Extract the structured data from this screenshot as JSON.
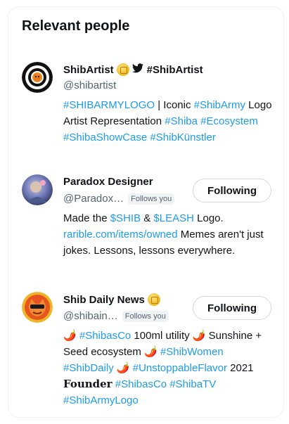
{
  "section": {
    "title": "Relevant people"
  },
  "people": [
    {
      "name": "ShibArtist",
      "name_suffix": "#ShibArtist",
      "handle": "@shibartist",
      "follows_you": "",
      "button": "",
      "bio": [
        {
          "t": "#SHIBARMYLOGO",
          "tag": true
        },
        {
          "t": " | Iconic ",
          "tag": false
        },
        {
          "t": "#ShibArmy",
          "tag": true
        },
        {
          "t": " Logo Artist Representation ",
          "tag": false
        },
        {
          "t": "#Shiba",
          "tag": true
        },
        {
          "t": " ",
          "tag": false
        },
        {
          "t": "#Ecosystem",
          "tag": true
        },
        {
          "t": " ",
          "tag": false
        },
        {
          "t": "#ShibaShowCase",
          "tag": true
        },
        {
          "t": " ",
          "tag": false
        },
        {
          "t": "#ShibKünstler",
          "tag": true
        }
      ]
    },
    {
      "name": "Paradox Designer",
      "name_suffix": "",
      "handle": "@Paradox…",
      "follows_you": "Follows you",
      "button": "Following",
      "bio": [
        {
          "t": "Made the ",
          "tag": false
        },
        {
          "t": "$SHIB",
          "tag": true
        },
        {
          "t": " & ",
          "tag": false
        },
        {
          "t": "$LEASH",
          "tag": true
        },
        {
          "t": " Logo. ",
          "tag": false
        },
        {
          "t": "rarible.com/items/owned",
          "tag": true
        },
        {
          "t": " Memes aren't just jokes. Lessons, lessons everywhere.",
          "tag": false
        }
      ]
    },
    {
      "name": "Shib Daily News",
      "name_suffix": "",
      "handle": "@shibain…",
      "follows_you": "Follows you",
      "button": "Following",
      "bio": [
        {
          "t": "🌶️ ",
          "tag": false
        },
        {
          "t": "#ShibasCo",
          "tag": true
        },
        {
          "t": " 100ml utility 🌶️ Sunshine + Seed ecosystem 🌶️ ",
          "tag": false
        },
        {
          "t": "#ShibWomen",
          "tag": true
        },
        {
          "t": " ",
          "tag": false
        },
        {
          "t": "#ShibDaily",
          "tag": true
        },
        {
          "t": " 🌶️ ",
          "tag": false
        },
        {
          "t": "#UnstoppableFlavor",
          "tag": true
        },
        {
          "t": " 2021 ",
          "tag": false
        },
        {
          "t": "Founder",
          "tag": false,
          "serif": true
        },
        {
          "t": " ",
          "tag": false
        },
        {
          "t": "#ShibasCo",
          "tag": true
        },
        {
          "t": " ",
          "tag": false
        },
        {
          "t": "#ShibaTV",
          "tag": true
        },
        {
          "t": " ",
          "tag": false
        },
        {
          "t": "#ShibArmyLogo",
          "tag": true
        }
      ]
    }
  ],
  "icons": {
    "verified": "gold-coin-icon",
    "twitter": "bird-icon"
  },
  "colors": {
    "link": "#1d9bf0",
    "text": "#0f1419",
    "secondary": "#536471",
    "border": "#cfd9de"
  }
}
